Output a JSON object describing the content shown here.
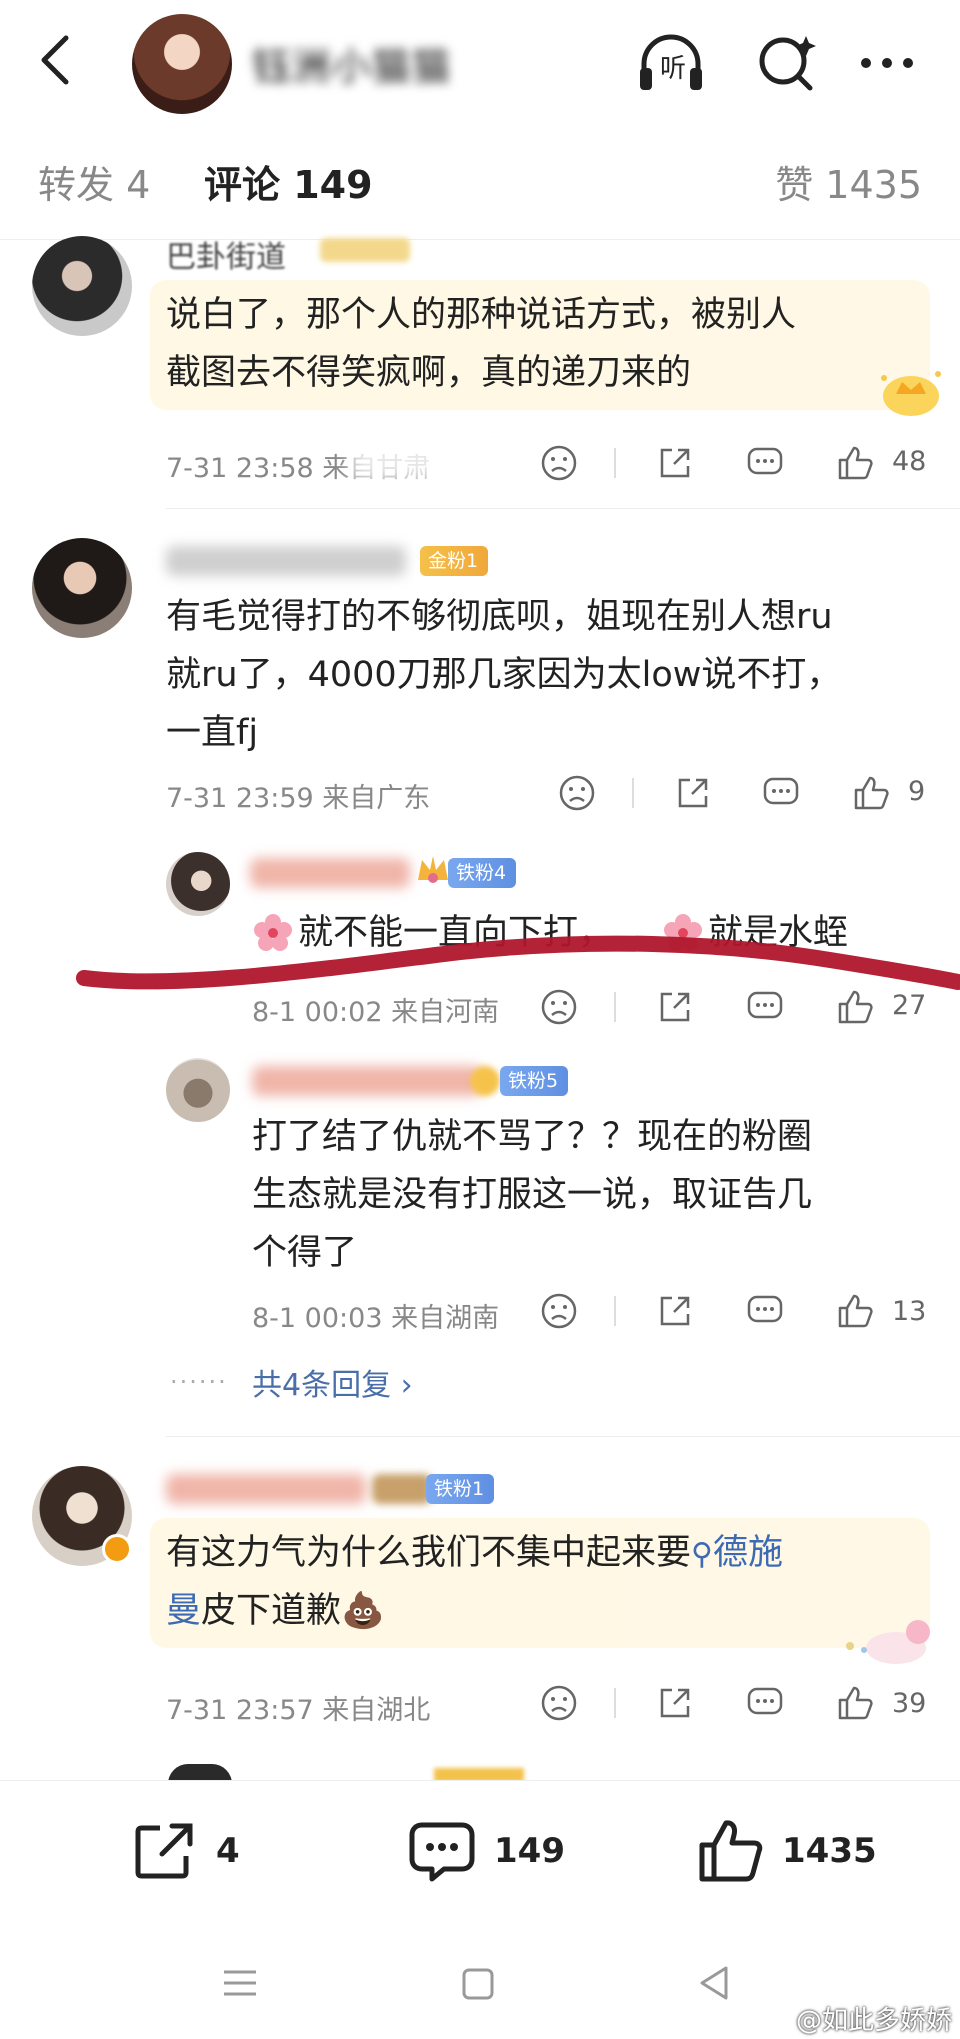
{
  "header": {
    "title": "钰洲小猫猫",
    "listen_label": "听"
  },
  "tabs": {
    "repost": "转发 4",
    "comment": "评论 149",
    "like": "赞 1435"
  },
  "comments": [
    {
      "name": "巴卦街道",
      "text_lines": [
        "说白了，那个人的那种说话方式，被别人",
        "截图去不得笑疯啊，真的递刀来的"
      ],
      "time": "7-31 23:58 来自甘肃",
      "likes": "48"
    },
    {
      "badge": "金粉1",
      "text_lines": [
        "有毛觉得打的不够彻底呗，姐现在别人想ru",
        "就ru了，4000刀那几家因为太low说不打，",
        "一直fj"
      ],
      "time": "7-31 23:59 来自广东",
      "likes": "9"
    },
    {
      "badge": "铁粉4",
      "text_a": "就不能一直向下打，",
      "text_b": "就是水蛭",
      "time": "8-1 00:02 来自河南",
      "likes": "27"
    },
    {
      "badge": "铁粉5",
      "text_lines": [
        "打了结了仇就不骂了？？现在的粉圈",
        "生态就是没有打服这一说，取证告几",
        "个得了"
      ],
      "time": "8-1 00:03 来自湖南",
      "likes": "13"
    },
    {
      "badge": "铁粉1",
      "text_line1": "有这力气为什么我们不集中起来要",
      "topic_a": "德施",
      "topic_b": "曼",
      "text_line2": "皮下道歉",
      "time": "7-31 23:57 来自湖北",
      "likes": "39"
    }
  ],
  "more_replies": "共4条回复 ›",
  "bottom": {
    "repost_count": "4",
    "comment_count": "149",
    "like_count": "1435"
  },
  "watermark": "@如此多娇娇"
}
